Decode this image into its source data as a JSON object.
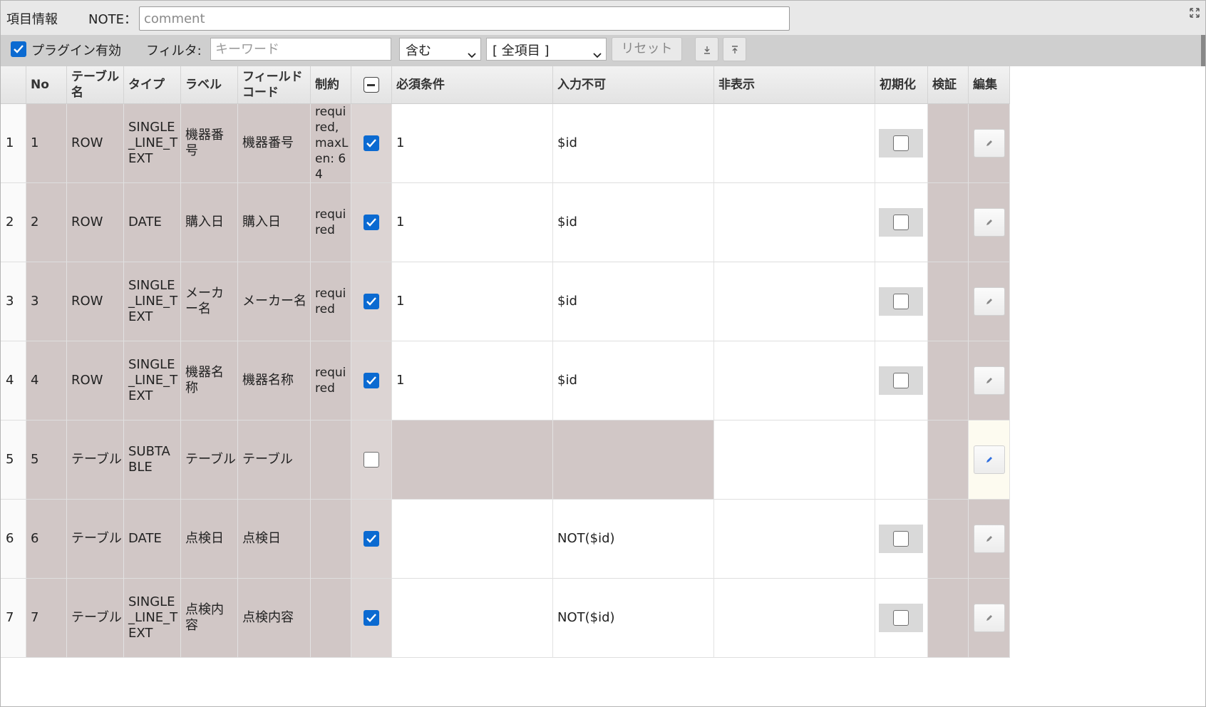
{
  "header": {
    "title": "項目情報",
    "note_label": "NOTE：",
    "note_placeholder": "comment"
  },
  "toolbar": {
    "plugin_enabled": true,
    "plugin_label": "プラグイン有効",
    "filter_label": "フィルタ:",
    "keyword_placeholder": "キーワード",
    "match_mode": "含む",
    "field_scope": "[ 全項目 ]",
    "reset_label": "リセット"
  },
  "icons": {
    "expand": "expand-icon",
    "download": "download-icon",
    "upload": "upload-icon",
    "edit": "pencil-icon"
  },
  "columns": {
    "no": "No",
    "table": "テーブル名",
    "type": "タイプ",
    "label": "ラベル",
    "field_code": "フィールドコード",
    "constraint": "制約",
    "required": "必須条件",
    "disabled": "入力不可",
    "hidden": "非表示",
    "init": "初期化",
    "validate": "検証",
    "edit": "編集"
  },
  "colors": {
    "accent": "#0b6ad1",
    "row_tan": "#d1c7c6",
    "toolbar": "#cfcfcf"
  },
  "rows": [
    {
      "rownum": "1",
      "no": "1",
      "table": "ROW",
      "type": "SINGLE_LINE_TEXT",
      "label": "機器番号",
      "field_code": "機器番号",
      "constraint": "required, maxLen: 64",
      "checked": true,
      "required": "1",
      "disabled": "$id",
      "hidden": "",
      "init_checked": false
    },
    {
      "rownum": "2",
      "no": "2",
      "table": "ROW",
      "type": "DATE",
      "label": "購入日",
      "field_code": "購入日",
      "constraint": "required",
      "checked": true,
      "required": "1",
      "disabled": "$id",
      "hidden": "",
      "init_checked": false
    },
    {
      "rownum": "3",
      "no": "3",
      "table": "ROW",
      "type": "SINGLE_LINE_TEXT",
      "label": "メーカー名",
      "field_code": "メーカー名",
      "constraint": "required",
      "checked": true,
      "required": "1",
      "disabled": "$id",
      "hidden": "",
      "init_checked": false
    },
    {
      "rownum": "4",
      "no": "4",
      "table": "ROW",
      "type": "SINGLE_LINE_TEXT",
      "label": "機器名称",
      "field_code": "機器名称",
      "constraint": "required",
      "checked": true,
      "required": "1",
      "disabled": "$id",
      "hidden": "",
      "init_checked": false
    },
    {
      "rownum": "5",
      "no": "5",
      "table": "テーブル",
      "type": "SUBTABLE",
      "label": "テーブル",
      "field_code": "テーブル",
      "constraint": "",
      "checked": false,
      "required": "",
      "disabled": "",
      "hidden": "",
      "init_checked": null
    },
    {
      "rownum": "6",
      "no": "6",
      "table": "テーブル",
      "type": "DATE",
      "label": "点検日",
      "field_code": "点検日",
      "constraint": "",
      "checked": true,
      "required": "",
      "disabled": "NOT($id)",
      "hidden": "",
      "init_checked": false
    },
    {
      "rownum": "7",
      "no": "7",
      "table": "テーブル",
      "type": "SINGLE_LINE_TEXT",
      "label": "点検内容",
      "field_code": "点検内容",
      "constraint": "",
      "checked": true,
      "required": "",
      "disabled": "NOT($id)",
      "hidden": "",
      "init_checked": false
    }
  ]
}
